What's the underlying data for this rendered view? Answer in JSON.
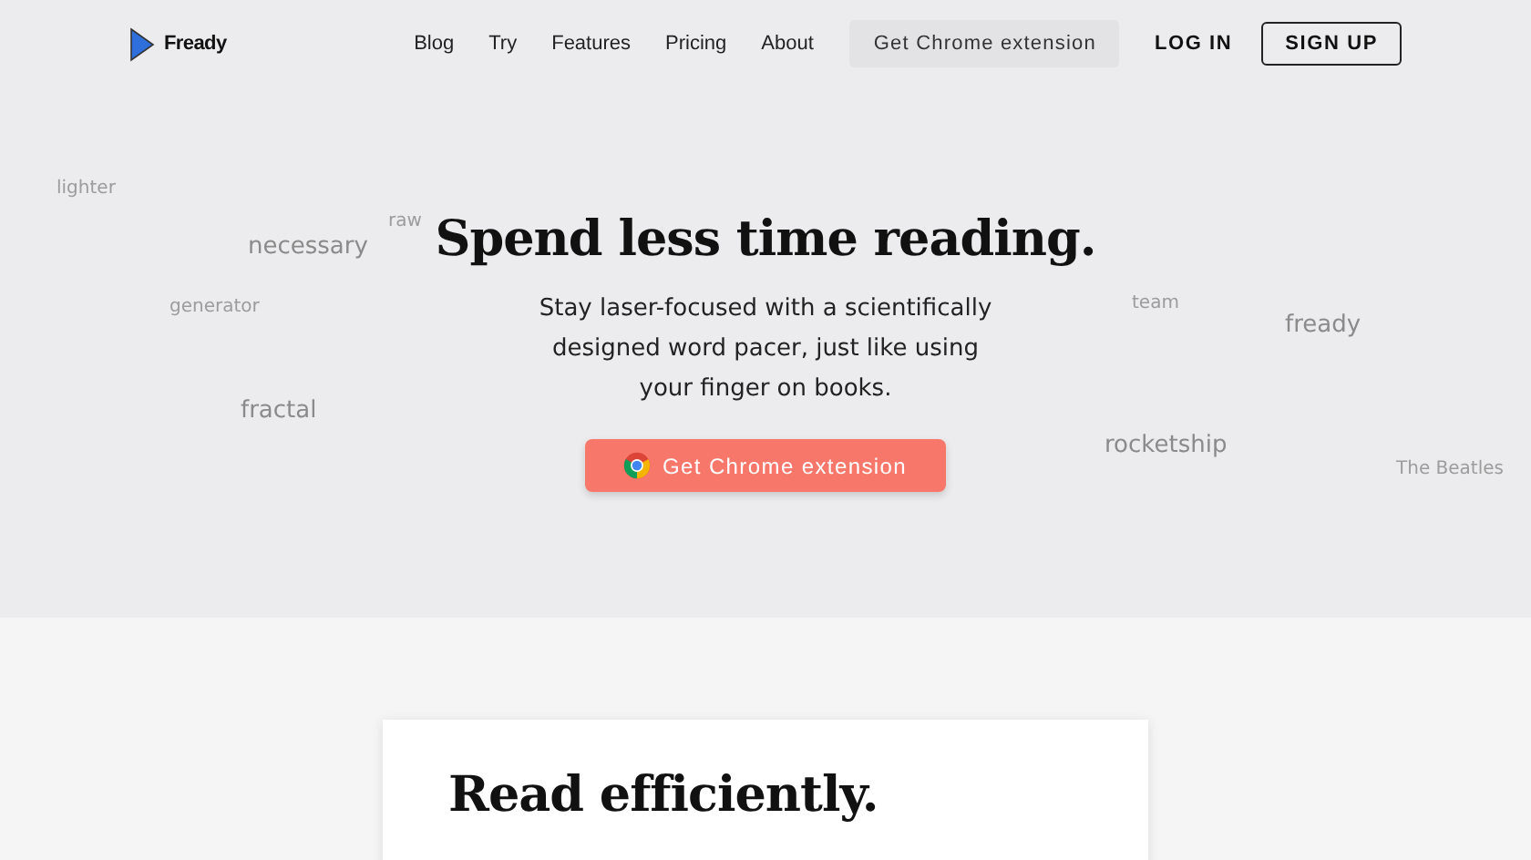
{
  "header": {
    "logo": "Fready",
    "nav": [
      "Blog",
      "Try",
      "Features",
      "Pricing",
      "About"
    ],
    "extension_button": "Get Chrome extension",
    "login": "LOG IN",
    "signup": "SIGN UP"
  },
  "hero": {
    "title": "Spend less time reading.",
    "subtitle": "Stay laser-focused with a scientifically designed word pacer, just like using your finger on books.",
    "cta": "Get Chrome extension",
    "floating_words": [
      {
        "text": "lighter",
        "kind": "far"
      },
      {
        "text": "necessary",
        "kind": "near"
      },
      {
        "text": "raw",
        "kind": "far"
      },
      {
        "text": "generator",
        "kind": "far"
      },
      {
        "text": "fractal",
        "kind": "near"
      },
      {
        "text": "team",
        "kind": "far"
      },
      {
        "text": "fready",
        "kind": "near"
      },
      {
        "text": "rocketship",
        "kind": "near"
      },
      {
        "text": "The Beatles",
        "kind": "far"
      }
    ]
  },
  "section": {
    "title": "Read efficiently."
  }
}
